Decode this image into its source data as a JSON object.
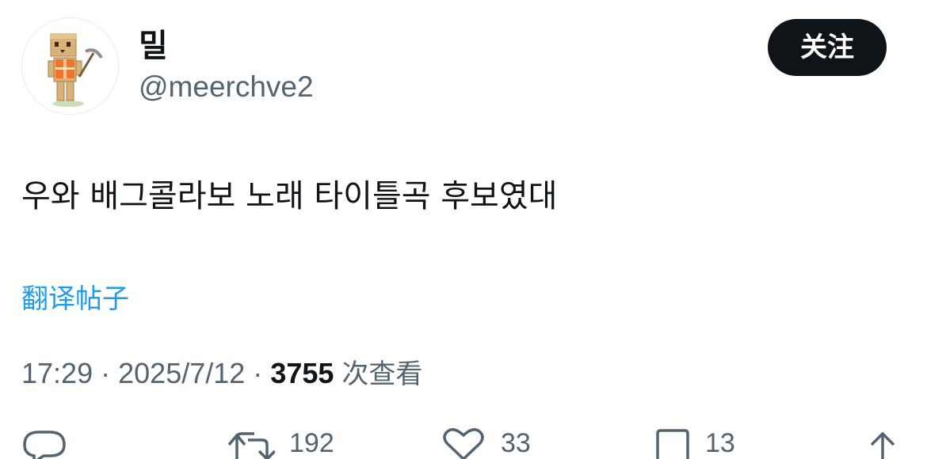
{
  "author": {
    "display_name": "밀",
    "handle": "@meerchve2"
  },
  "follow_button": {
    "label": "关注"
  },
  "post": {
    "text": "우와 배그콜라보 노래 타이틀곡 후보였대",
    "translate_label": "翻译帖子"
  },
  "meta": {
    "time": "17:29",
    "separator": "·",
    "date": "2025/7/12",
    "views_count": "3755",
    "views_label": "次查看"
  },
  "actions": {
    "retweet_count": "192",
    "like_count": "33",
    "bookmark_count": "13"
  },
  "colors": {
    "primary_text": "#0f1419",
    "secondary_text": "#536471",
    "link": "#1d9bf0",
    "button_bg": "#0f1419"
  }
}
